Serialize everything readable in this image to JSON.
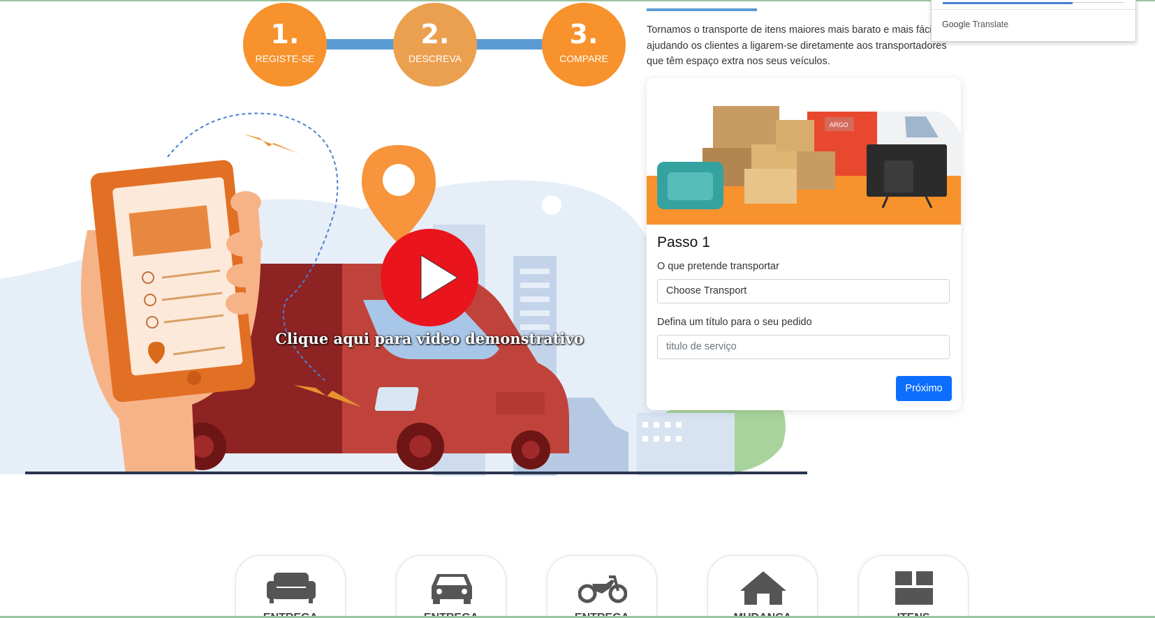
{
  "steps": [
    {
      "number": "1.",
      "label": "REGISTE-SE"
    },
    {
      "number": "2.",
      "label": "DESCREVA"
    },
    {
      "number": "3.",
      "label": "COMPARE"
    }
  ],
  "intro_text": "Tornamos o transporte de itens maiores mais barato e mais fácil, ajudando os clientes a ligarem-se diretamente aos transportadores que têm espaço extra nos seus veículos.",
  "video": {
    "caption": "Clique aqui para video demonstrativo",
    "icon": "play-icon"
  },
  "form": {
    "title": "Passo 1",
    "transport_label": "O que pretende transportar",
    "transport_value": "Choose Transport",
    "title_label": "Defina um título para o seu pedido",
    "title_placeholder": "titulo de serviço",
    "next_label": "Próximo",
    "image_badge": "ARGO"
  },
  "translate": {
    "brand": "Google",
    "product": "Translate"
  },
  "categories": [
    {
      "icon": "sofa-icon",
      "label": "ENTREGA"
    },
    {
      "icon": "car-icon",
      "label": "ENTREGA"
    },
    {
      "icon": "motorcycle-icon",
      "label": "ENTREGA"
    },
    {
      "icon": "house-icon",
      "label": "MUDANÇA"
    },
    {
      "icon": "box-icon",
      "label": "ITENS"
    }
  ],
  "colors": {
    "orange": "#f7922d",
    "blue": "#5b9bd5",
    "play_red": "#e9141c",
    "button_blue": "#0d6efd"
  }
}
